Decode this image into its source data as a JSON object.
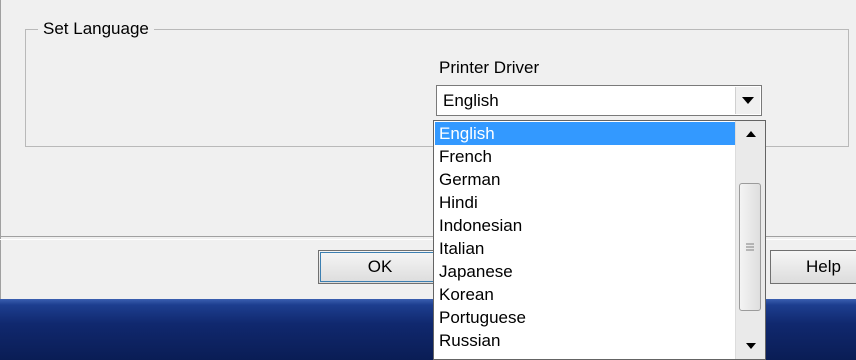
{
  "group": {
    "title": "Set Language"
  },
  "printer_driver": {
    "label": "Printer Driver",
    "selected": "English"
  },
  "dropdown": {
    "items": [
      "English",
      "French",
      "German",
      "Hindi",
      "Indonesian",
      "Italian",
      "Japanese",
      "Korean",
      "Portuguese",
      "Russian"
    ],
    "selected_index": 0
  },
  "buttons": {
    "ok": "OK",
    "help": "Help"
  },
  "icons": {
    "combo_arrow": "chevron-down-icon",
    "scroll_up": "scroll-up-arrow-icon",
    "scroll_down": "scroll-down-arrow-icon",
    "thumb_grip": "grip-icon"
  },
  "colors": {
    "selection": "#3399ff",
    "taskbar": "#10286e"
  }
}
